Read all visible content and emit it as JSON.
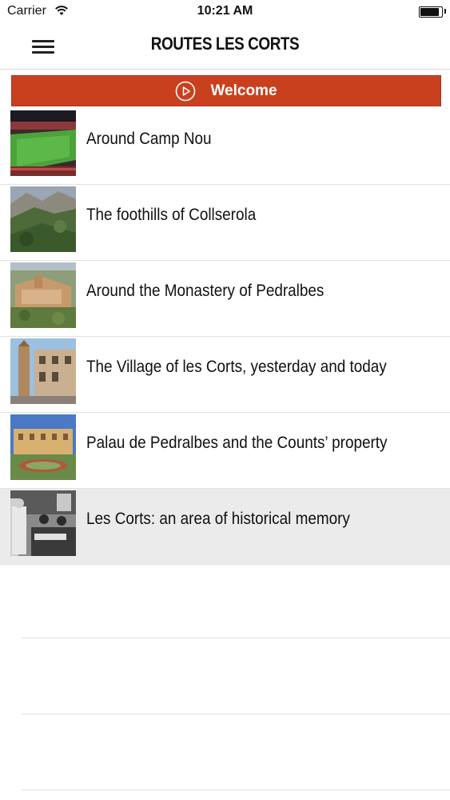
{
  "status_bar": {
    "carrier": "Carrier",
    "time": "10:21 AM",
    "battery_level": 0.9
  },
  "nav": {
    "title": "ROUTES LES CORTS",
    "menu_icon": "hamburger-icon"
  },
  "welcome": {
    "label": "Welcome",
    "icon": "play-circle-icon",
    "color": "#c9401f"
  },
  "routes": [
    {
      "title": "Around Camp Nou",
      "thumbnail": "stadium-photo"
    },
    {
      "title": "The foothills of Collserola",
      "thumbnail": "hills-photo"
    },
    {
      "title": "Around the Monastery of Pedralbes",
      "thumbnail": "monastery-photo"
    },
    {
      "title": "The Village of les Corts, yesterday and today",
      "thumbnail": "village-street-photo"
    },
    {
      "title": "Palau de Pedralbes and the Counts’ property",
      "thumbnail": "palace-photo"
    },
    {
      "title": "Les Corts: an area of historical memory",
      "thumbnail": "historical-bw-photo",
      "selected": true
    }
  ]
}
